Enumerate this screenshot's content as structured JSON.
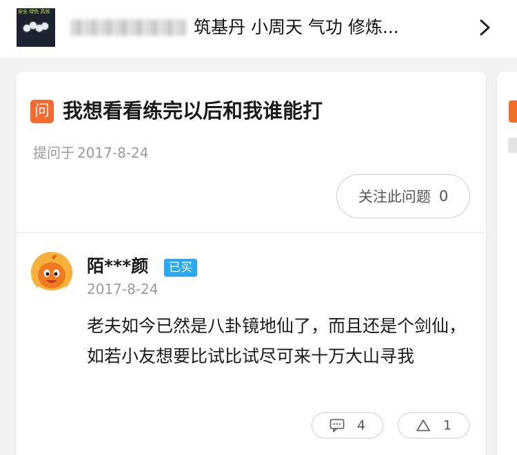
{
  "topbar": {
    "thumbnail_icon": "course-thumbnail-image",
    "thumbnail_caption_top": "安全 绿色 高效",
    "thumbnail_caption_bottom": "",
    "blurred_prefix": "",
    "topic_tags": "筑基丹 小周天 气功 修炼...",
    "chevron_icon": "chevron-right-icon"
  },
  "question": {
    "badge_char": "问",
    "title": "我想看看练完以后和我谁能打",
    "date_prefix": "提问于",
    "date": "2017-8-24",
    "follow_label": "关注此问题",
    "follow_count": "0"
  },
  "answer": {
    "avatar_icon": "orange-mascot-avatar",
    "author": "陌***颜",
    "bought_badge": "已买",
    "date": "2017-8-24",
    "body": "老夫如今已然是八卦镜地仙了，而且还是个剑仙，如若小友想要比试比试尽可来十万大山寻我",
    "comment_icon": "comment-icon",
    "comment_count": "4",
    "like_icon": "upvote-triangle-icon",
    "like_count": "1"
  },
  "colors": {
    "badge_orange": "#f5692e",
    "bought_blue": "#2aa9f2",
    "muted_gray": "#9a9a9a",
    "background": "#f2f2f2"
  }
}
